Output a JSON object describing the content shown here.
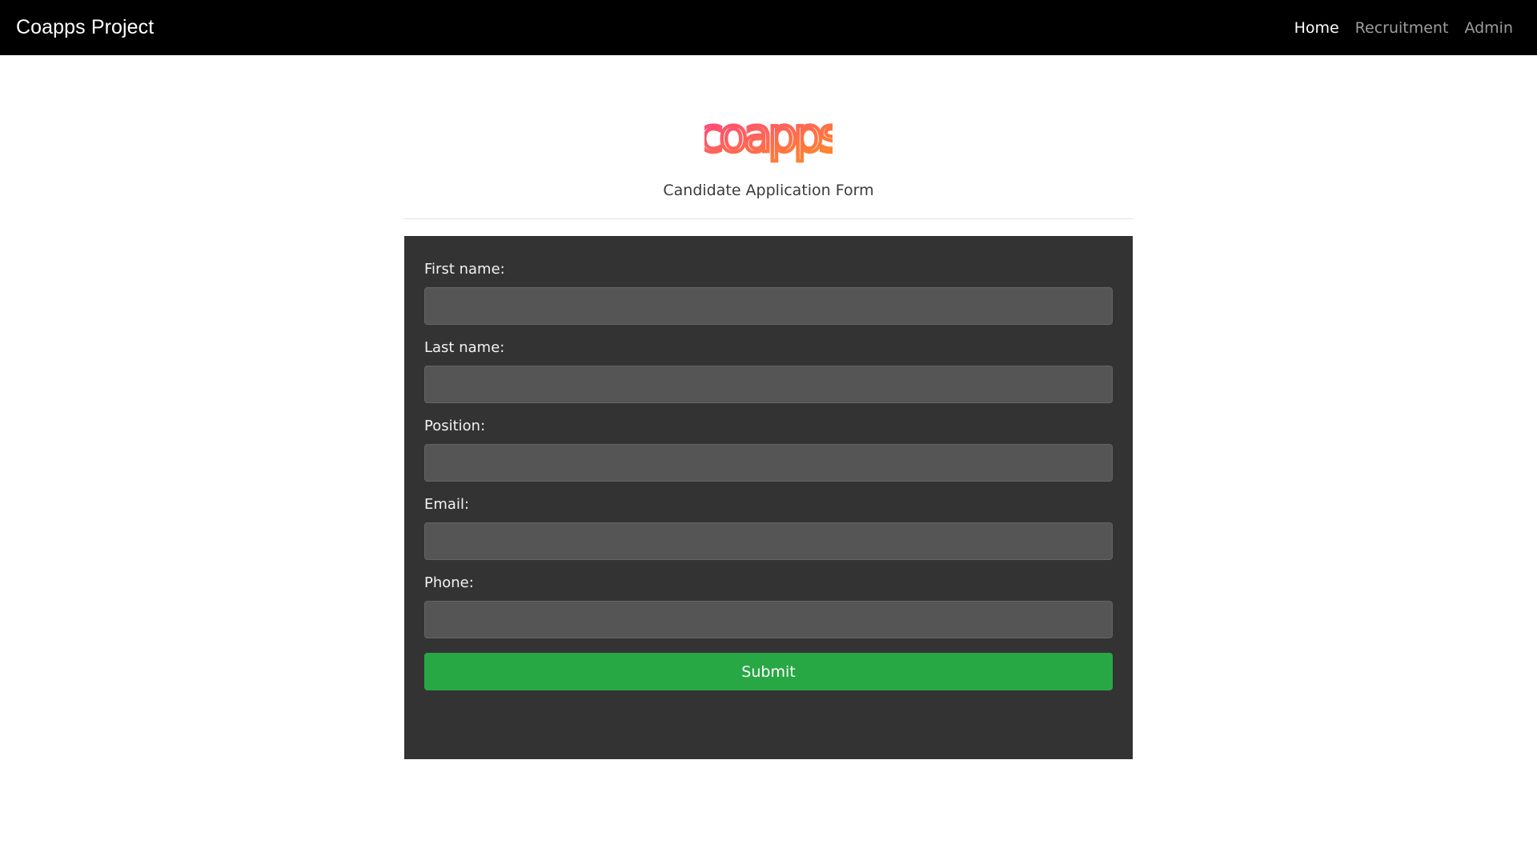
{
  "navbar": {
    "brand": "Coapps Project",
    "links": [
      {
        "label": "Home",
        "active": true
      },
      {
        "label": "Recruitment",
        "active": false
      },
      {
        "label": "Admin",
        "active": false
      }
    ]
  },
  "header": {
    "logo_text": "coapps",
    "subtitle": "Candidate Application Form"
  },
  "form": {
    "fields": [
      {
        "label": "First name:",
        "value": ""
      },
      {
        "label": "Last name:",
        "value": ""
      },
      {
        "label": "Position:",
        "value": ""
      },
      {
        "label": "Email:",
        "value": ""
      },
      {
        "label": "Phone:",
        "value": ""
      }
    ],
    "submit_label": "Submit"
  },
  "colors": {
    "navbar_bg": "#000000",
    "card_bg": "#333333",
    "input_bg": "#555555",
    "submit_bg": "#28a745",
    "logo_gradient_start": "#ff4081",
    "logo_gradient_end": "#ff9800"
  }
}
